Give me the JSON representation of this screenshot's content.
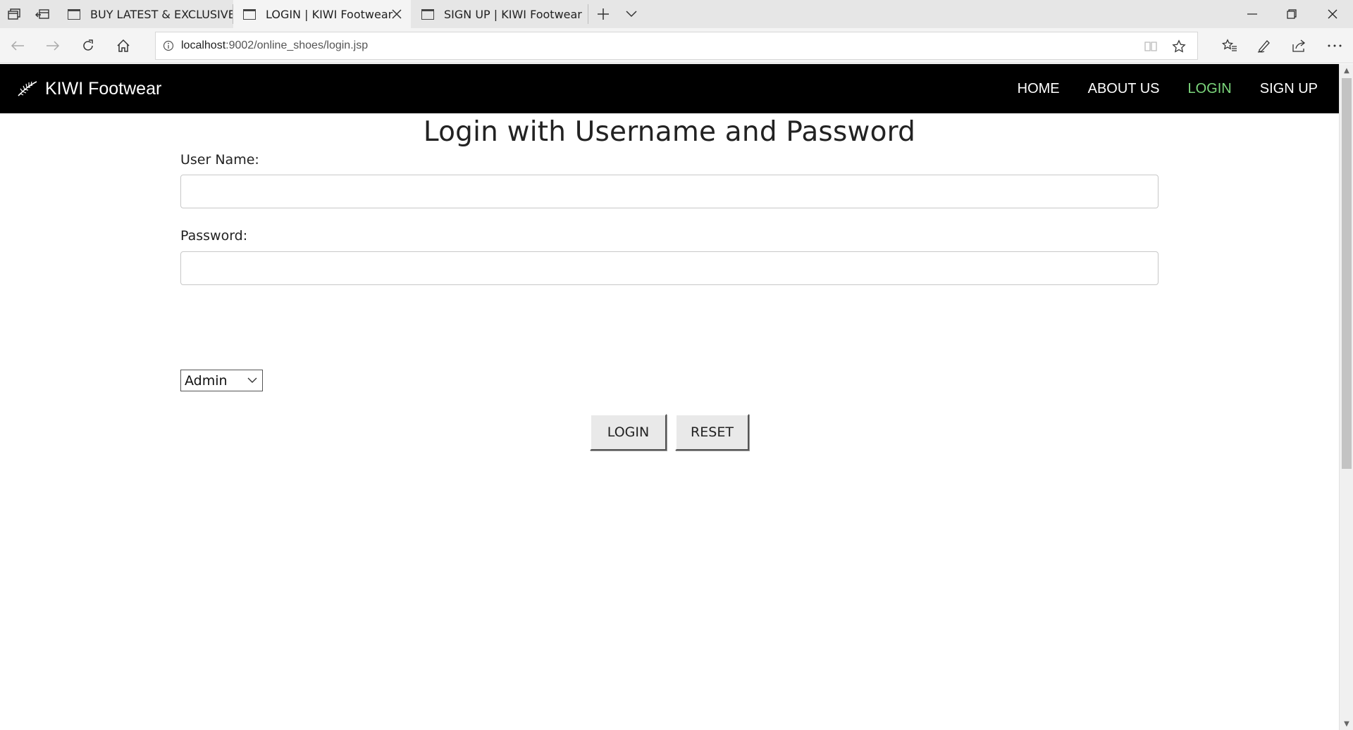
{
  "browser": {
    "tabs": [
      {
        "title": "BUY LATEST & EXCLUSIVE F",
        "active": false
      },
      {
        "title": "LOGIN | KIWI Footwear",
        "active": true
      },
      {
        "title": "SIGN UP | KIWI Footwear",
        "active": false
      }
    ],
    "address": {
      "host": "localhost",
      "path": ":9002/online_shoes/login.jsp"
    }
  },
  "site": {
    "brand": "KIWI Footwear",
    "nav": [
      {
        "label": "HOME",
        "current": false
      },
      {
        "label": "ABOUT US",
        "current": false
      },
      {
        "label": "LOGIN",
        "current": true
      },
      {
        "label": "SIGN UP",
        "current": false
      }
    ],
    "accent_color": "#7dd87d"
  },
  "login": {
    "title": "Login with Username and Password",
    "username_label": "User Name:",
    "username_value": "",
    "password_label": "Password:",
    "password_value": "",
    "role_selected": "Admin",
    "login_button": "LOGIN",
    "reset_button": "RESET"
  }
}
